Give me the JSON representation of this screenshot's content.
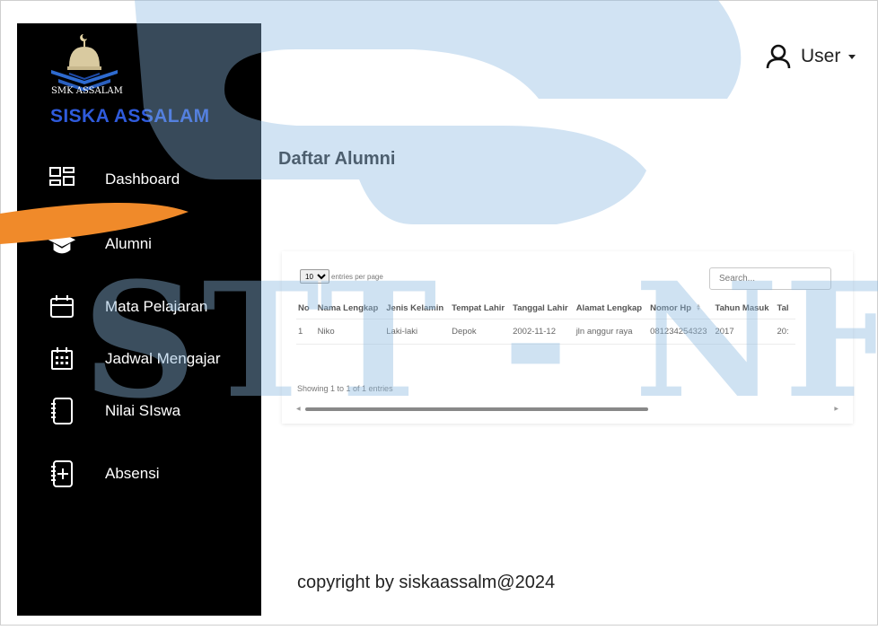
{
  "sidebar": {
    "school_name": "SMK ASSALAM",
    "brand": "SISKA ASSALAM",
    "items": [
      {
        "label": "Dashboard",
        "icon": "dashboard-icon"
      },
      {
        "label": "Alumni",
        "icon": "graduation-cap-icon"
      },
      {
        "label": "Mata Pelajaran",
        "icon": "calendar-icon"
      },
      {
        "label": "Jadwal Mengajar",
        "icon": "calendar-grid-icon"
      },
      {
        "label": "Nilai SIswa",
        "icon": "notebook-icon"
      },
      {
        "label": "Absensi",
        "icon": "notebook-plus-icon"
      }
    ]
  },
  "header": {
    "user_label": "User",
    "user_icon": "user-icon"
  },
  "main": {
    "title": "Daftar Alumni",
    "copyright": "copyright by siskaassalm@2024"
  },
  "table": {
    "entries_value": "10",
    "entries_label": "entries per page",
    "search_placeholder": "Search...",
    "columns": [
      "No",
      "Nama Lengkap",
      "Jenis Kelamin",
      "Tempat Lahir",
      "Tanggal Lahir",
      "Alamat Lengkap",
      "Nomor Hp",
      "Tahun Masuk",
      "Tal"
    ],
    "rows": [
      [
        "1",
        "Niko",
        "Laki-laki",
        "Depok",
        "2002-11-12",
        "jln anggur raya",
        "081234254323",
        "2017",
        "20:"
      ]
    ],
    "info": "Showing 1 to 1 of 1 entries"
  },
  "watermark": {
    "text": "STT - NF",
    "color": "#8cb9e1"
  },
  "colors": {
    "sidebar_bg": "#000000",
    "brand": "#2f5bdc",
    "accent_orange": "#f08a2a"
  }
}
